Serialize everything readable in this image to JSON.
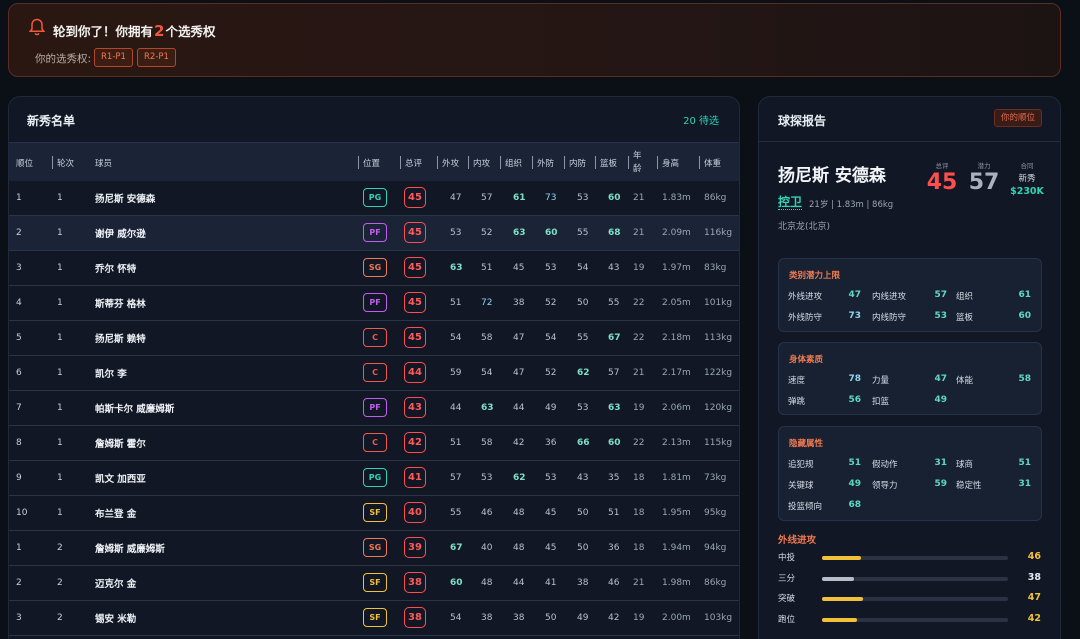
{
  "banner": {
    "title_pre": "轮到你了！你拥有",
    "title_num": "2",
    "title_post": "个选秀权",
    "picks_label": "你的选秀权:",
    "picks": [
      "R1-P1",
      "R2-P1"
    ]
  },
  "roster": {
    "title": "新秀名单",
    "pending": "20 待选",
    "columns": {
      "rank": "顺位",
      "round": "轮次",
      "player": "球员",
      "position": "位置",
      "overall": "总评",
      "outside": "外攻",
      "inside": "内攻",
      "playmaking": "组织",
      "perimeter_d": "外防",
      "interior_d": "内防",
      "rebound": "篮板",
      "age_top": "年",
      "age_bottom": "龄",
      "height": "身高",
      "weight": "体重"
    },
    "rows": [
      {
        "rank": "1",
        "round": "1",
        "name": "扬尼斯 安德森",
        "pos": "PG",
        "ovr": "45",
        "stats": [
          "47",
          "57",
          "61",
          "73",
          "53",
          "60"
        ],
        "age": "21",
        "height": "1.83m",
        "weight": "86kg"
      },
      {
        "rank": "2",
        "round": "1",
        "name": "谢伊 威尔逊",
        "pos": "PF",
        "ovr": "45",
        "stats": [
          "53",
          "52",
          "63",
          "60",
          "55",
          "68"
        ],
        "age": "21",
        "height": "2.09m",
        "weight": "116kg"
      },
      {
        "rank": "3",
        "round": "1",
        "name": "乔尔 怀特",
        "pos": "SG",
        "ovr": "45",
        "stats": [
          "63",
          "51",
          "45",
          "53",
          "54",
          "43"
        ],
        "age": "19",
        "height": "1.97m",
        "weight": "83kg"
      },
      {
        "rank": "4",
        "round": "1",
        "name": "斯蒂芬 格林",
        "pos": "PF",
        "ovr": "45",
        "stats": [
          "51",
          "72",
          "38",
          "52",
          "50",
          "55"
        ],
        "age": "22",
        "height": "2.05m",
        "weight": "101kg"
      },
      {
        "rank": "5",
        "round": "1",
        "name": "扬尼斯 赖特",
        "pos": "C",
        "ovr": "45",
        "stats": [
          "54",
          "58",
          "47",
          "54",
          "55",
          "67"
        ],
        "age": "22",
        "height": "2.18m",
        "weight": "113kg"
      },
      {
        "rank": "6",
        "round": "1",
        "name": "凯尔 李",
        "pos": "C",
        "ovr": "44",
        "stats": [
          "59",
          "54",
          "47",
          "52",
          "62",
          "57"
        ],
        "age": "21",
        "height": "2.17m",
        "weight": "122kg"
      },
      {
        "rank": "7",
        "round": "1",
        "name": "帕斯卡尔 威廉姆斯",
        "pos": "PF",
        "ovr": "43",
        "stats": [
          "44",
          "63",
          "44",
          "49",
          "53",
          "63"
        ],
        "age": "19",
        "height": "2.06m",
        "weight": "120kg"
      },
      {
        "rank": "8",
        "round": "1",
        "name": "詹姆斯 霍尔",
        "pos": "C",
        "ovr": "42",
        "stats": [
          "51",
          "58",
          "42",
          "36",
          "66",
          "60"
        ],
        "age": "22",
        "height": "2.13m",
        "weight": "115kg"
      },
      {
        "rank": "9",
        "round": "1",
        "name": "凯文 加西亚",
        "pos": "PG",
        "ovr": "41",
        "stats": [
          "57",
          "53",
          "62",
          "53",
          "43",
          "35"
        ],
        "age": "18",
        "height": "1.81m",
        "weight": "73kg"
      },
      {
        "rank": "10",
        "round": "1",
        "name": "布兰登 金",
        "pos": "SF",
        "ovr": "40",
        "stats": [
          "55",
          "46",
          "48",
          "45",
          "50",
          "51"
        ],
        "age": "18",
        "height": "1.95m",
        "weight": "95kg"
      },
      {
        "rank": "1",
        "round": "2",
        "name": "詹姆斯 威廉姆斯",
        "pos": "SG",
        "ovr": "39",
        "stats": [
          "67",
          "40",
          "48",
          "45",
          "50",
          "36"
        ],
        "age": "18",
        "height": "1.94m",
        "weight": "94kg"
      },
      {
        "rank": "2",
        "round": "2",
        "name": "迈克尔 金",
        "pos": "SF",
        "ovr": "38",
        "stats": [
          "60",
          "48",
          "44",
          "41",
          "38",
          "46"
        ],
        "age": "21",
        "height": "1.98m",
        "weight": "86kg"
      },
      {
        "rank": "3",
        "round": "2",
        "name": "锡安 米勒",
        "pos": "SF",
        "ovr": "38",
        "stats": [
          "54",
          "38",
          "38",
          "50",
          "49",
          "42"
        ],
        "age": "19",
        "height": "2.00m",
        "weight": "103kg"
      }
    ]
  },
  "position_colors": {
    "PG": "#2fd3b5",
    "PF": "#c35cf0",
    "SG": "#f07a52",
    "C": "#f05a4a",
    "SF": "#f2c13a"
  },
  "scout": {
    "title": "球探报告",
    "your_pick": "你的顺位",
    "name": "扬尼斯 安德森",
    "position": "控卫",
    "meta": "21岁 | 1.83m | 86kg",
    "origin": "北京龙(北京)",
    "overall_label": "总评",
    "overall": "45",
    "potential_label": "潜力",
    "potential": "57",
    "contract_label": "合同",
    "contract_type": "新秀",
    "contract_value": "$230K",
    "potential_box": {
      "title": "类别潜力上限",
      "items": [
        {
          "label": "外线进攻",
          "value": "47"
        },
        {
          "label": "内线进攻",
          "value": "57"
        },
        {
          "label": "组织",
          "value": "61"
        },
        {
          "label": "外线防守",
          "value": "73"
        },
        {
          "label": "内线防守",
          "value": "53"
        },
        {
          "label": "篮板",
          "value": "60"
        }
      ]
    },
    "physical_box": {
      "title": "身体素质",
      "items": [
        {
          "label": "速度",
          "value": "78"
        },
        {
          "label": "力量",
          "value": "47"
        },
        {
          "label": "体能",
          "value": "58"
        },
        {
          "label": "弹跳",
          "value": "56"
        },
        {
          "label": "扣篮",
          "value": "49"
        }
      ]
    },
    "hidden_box": {
      "title": "隐藏属性",
      "items": [
        {
          "label": "追犯规",
          "value": "51"
        },
        {
          "label": "假动作",
          "value": "31"
        },
        {
          "label": "球商",
          "value": "51"
        },
        {
          "label": "关键球",
          "value": "49"
        },
        {
          "label": "领导力",
          "value": "59"
        },
        {
          "label": "稳定性",
          "value": "31"
        },
        {
          "label": "投篮倾向",
          "value": "68"
        }
      ]
    },
    "outside_section": {
      "title": "外线进攻",
      "bars": [
        {
          "label": "中投",
          "value": "46",
          "fraction": 0.21,
          "color": "#f2c13a"
        },
        {
          "label": "三分",
          "value": "38",
          "fraction": 0.17,
          "color": "#b8bec8"
        },
        {
          "label": "突破",
          "value": "47",
          "fraction": 0.22,
          "color": "#f2c13a"
        },
        {
          "label": "跑位",
          "value": "42",
          "fraction": 0.19,
          "color": "#f2c13a"
        }
      ]
    }
  }
}
